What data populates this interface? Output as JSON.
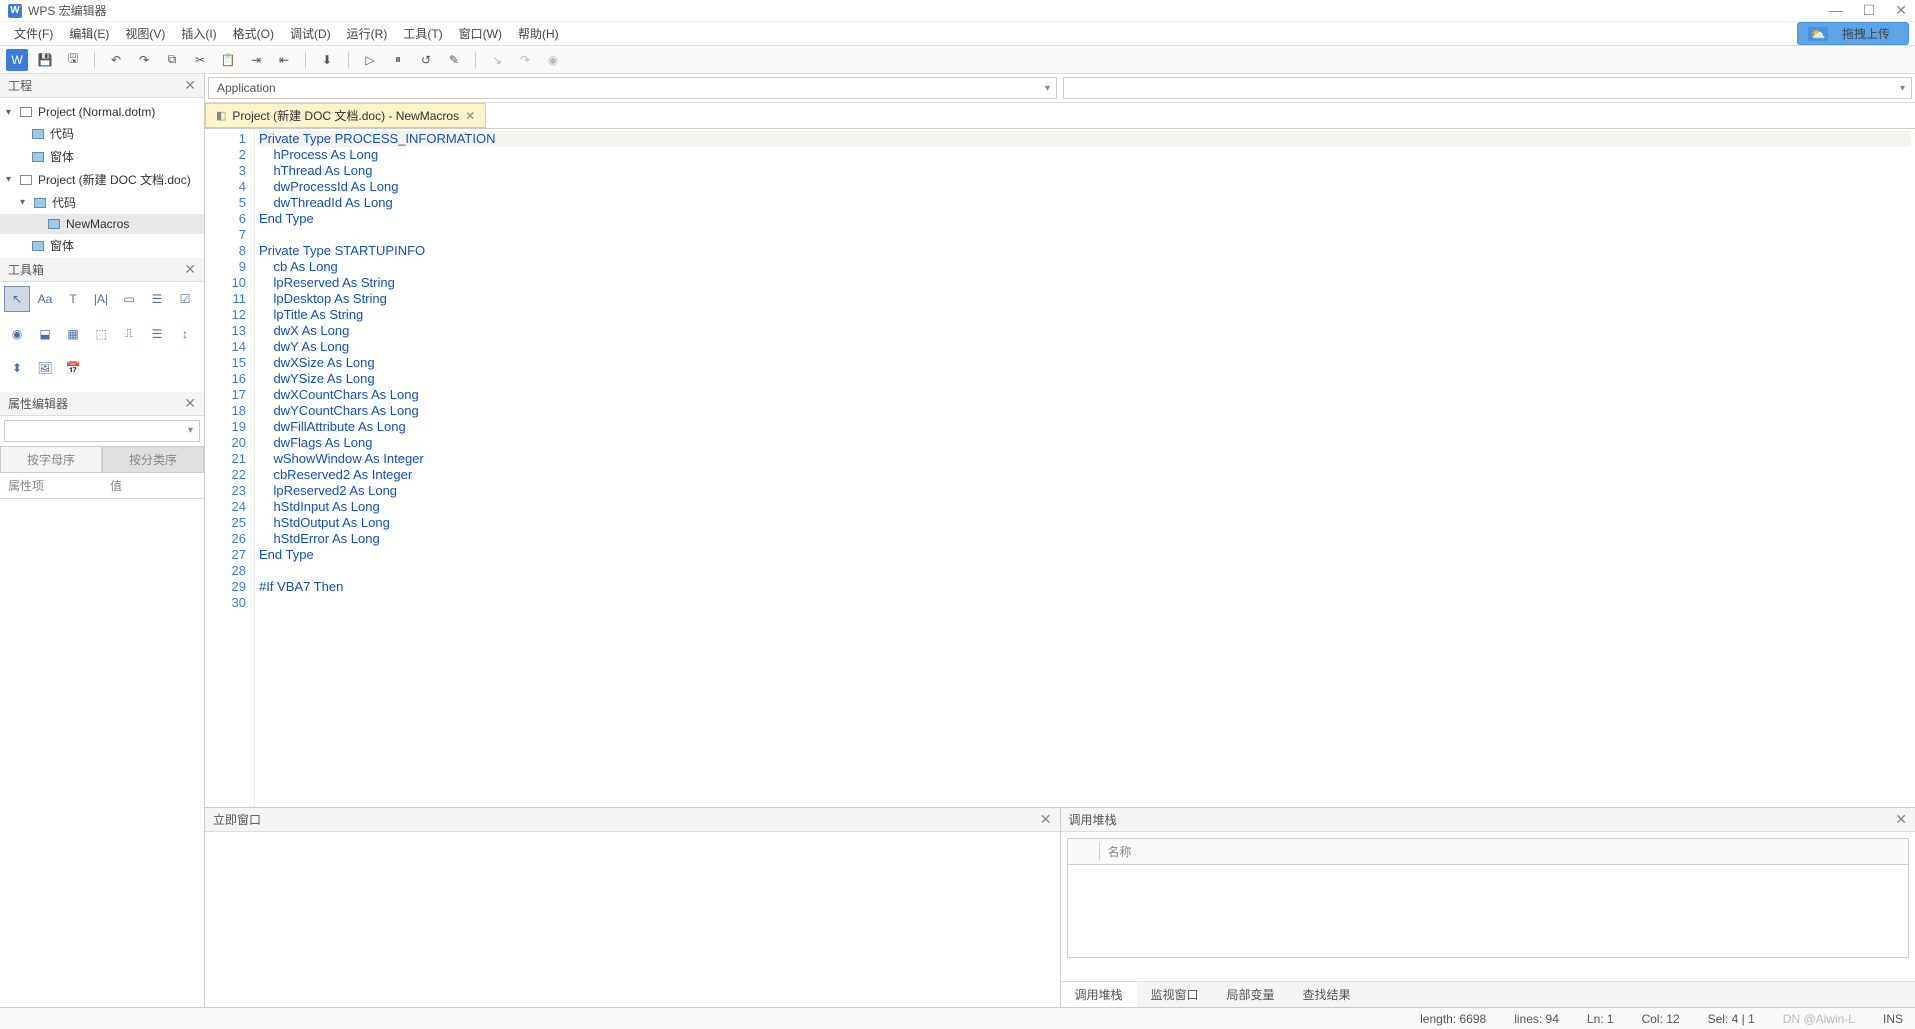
{
  "title": "WPS 宏编辑器",
  "upload_label": "拖拽上传",
  "menu": [
    "文件(F)",
    "编辑(E)",
    "视图(V)",
    "插入(I)",
    "格式(O)",
    "调试(D)",
    "运行(R)",
    "工具(T)",
    "窗口(W)",
    "帮助(H)"
  ],
  "panels": {
    "project": "工程",
    "toolbox": "工具箱",
    "property": "属性编辑器"
  },
  "tree": {
    "proj1": "Project (Normal.dotm)",
    "proj1_code": "代码",
    "proj1_form": "窗体",
    "proj2": "Project (新建 DOC 文档.doc)",
    "proj2_code": "代码",
    "proj2_macros": "NewMacros",
    "proj2_form": "窗体"
  },
  "prop_tabs": {
    "alpha": "按字母序",
    "cat": "按分类序"
  },
  "prop_cols": {
    "name": "属性项",
    "value": "值"
  },
  "selector_left": "Application",
  "editor_tab": "Project (新建 DOC 文档.doc) - NewMacros",
  "code": [
    {
      "n": 1,
      "t": "Private Type PROCESS_INFORMATION",
      "hl": true
    },
    {
      "n": 2,
      "t": "    hProcess As Long"
    },
    {
      "n": 3,
      "t": "    hThread As Long"
    },
    {
      "n": 4,
      "t": "    dwProcessId As Long"
    },
    {
      "n": 5,
      "t": "    dwThreadId As Long"
    },
    {
      "n": 6,
      "t": "End Type"
    },
    {
      "n": 7,
      "t": ""
    },
    {
      "n": 8,
      "t": "Private Type STARTUPINFO"
    },
    {
      "n": 9,
      "t": "    cb As Long"
    },
    {
      "n": 10,
      "t": "    lpReserved As String"
    },
    {
      "n": 11,
      "t": "    lpDesktop As String"
    },
    {
      "n": 12,
      "t": "    lpTitle As String"
    },
    {
      "n": 13,
      "t": "    dwX As Long"
    },
    {
      "n": 14,
      "t": "    dwY As Long"
    },
    {
      "n": 15,
      "t": "    dwXSize As Long"
    },
    {
      "n": 16,
      "t": "    dwYSize As Long"
    },
    {
      "n": 17,
      "t": "    dwXCountChars As Long"
    },
    {
      "n": 18,
      "t": "    dwYCountChars As Long"
    },
    {
      "n": 19,
      "t": "    dwFillAttribute As Long"
    },
    {
      "n": 20,
      "t": "    dwFlags As Long"
    },
    {
      "n": 21,
      "t": "    wShowWindow As Integer"
    },
    {
      "n": 22,
      "t": "    cbReserved2 As Integer"
    },
    {
      "n": 23,
      "t": "    lpReserved2 As Long"
    },
    {
      "n": 24,
      "t": "    hStdInput As Long"
    },
    {
      "n": 25,
      "t": "    hStdOutput As Long"
    },
    {
      "n": 26,
      "t": "    hStdError As Long"
    },
    {
      "n": 27,
      "t": "End Type"
    },
    {
      "n": 28,
      "t": ""
    },
    {
      "n": 29,
      "t": "#If VBA7 Then"
    },
    {
      "n": 30,
      "t": ""
    }
  ],
  "immediate": "立即窗口",
  "callstack": "调用堆栈",
  "callstack_col": "名称",
  "bottom_tabs": [
    "调用堆栈",
    "监视窗口",
    "局部变量",
    "查找结果"
  ],
  "status": {
    "length": "length:  6698",
    "lines": "lines:  94",
    "ln": "Ln:  1",
    "col": "Col:  12",
    "sel": "Sel:  4 | 1",
    "ins": "INS",
    "watermark": "DN @Aiwin-L"
  }
}
